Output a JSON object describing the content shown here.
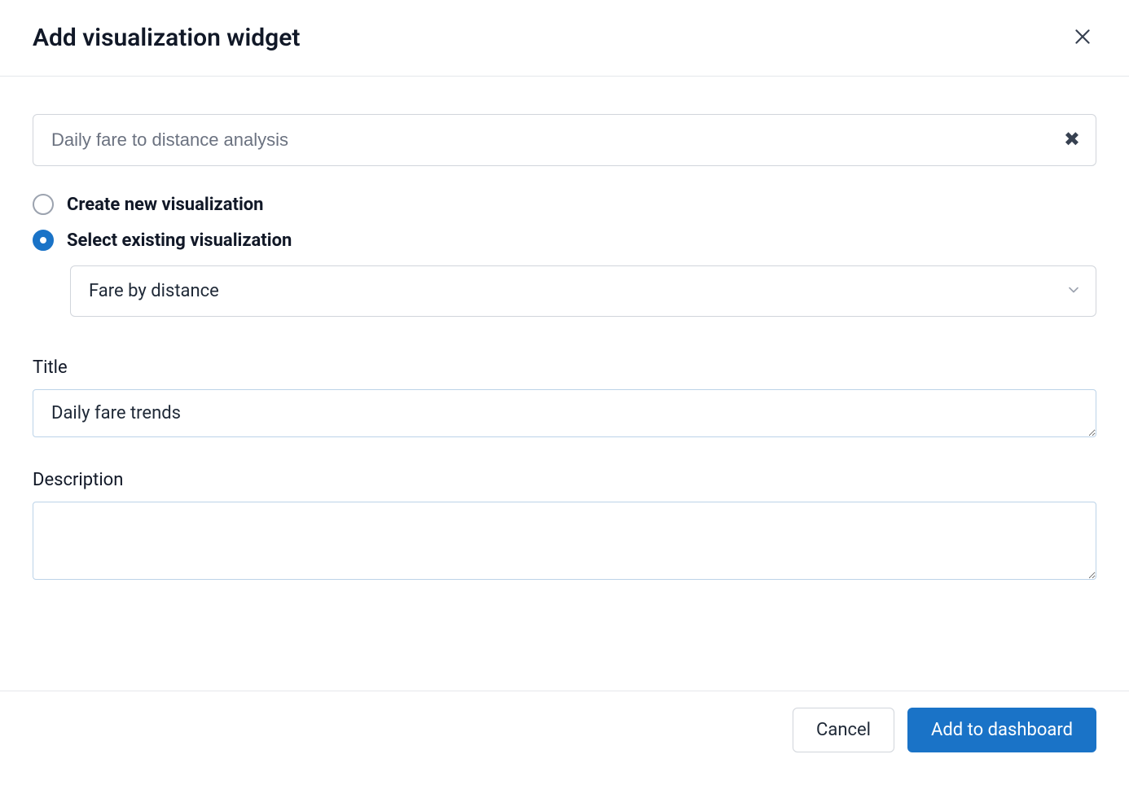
{
  "header": {
    "title": "Add visualization widget"
  },
  "search": {
    "value": "Daily fare to distance analysis"
  },
  "radio": {
    "create_label": "Create new visualization",
    "select_label": "Select existing visualization",
    "selected": "existing"
  },
  "visualization_select": {
    "value": "Fare by distance"
  },
  "title_field": {
    "label": "Title",
    "value": "Daily fare trends"
  },
  "description_field": {
    "label": "Description",
    "value": ""
  },
  "footer": {
    "cancel_label": "Cancel",
    "add_label": "Add to dashboard"
  }
}
